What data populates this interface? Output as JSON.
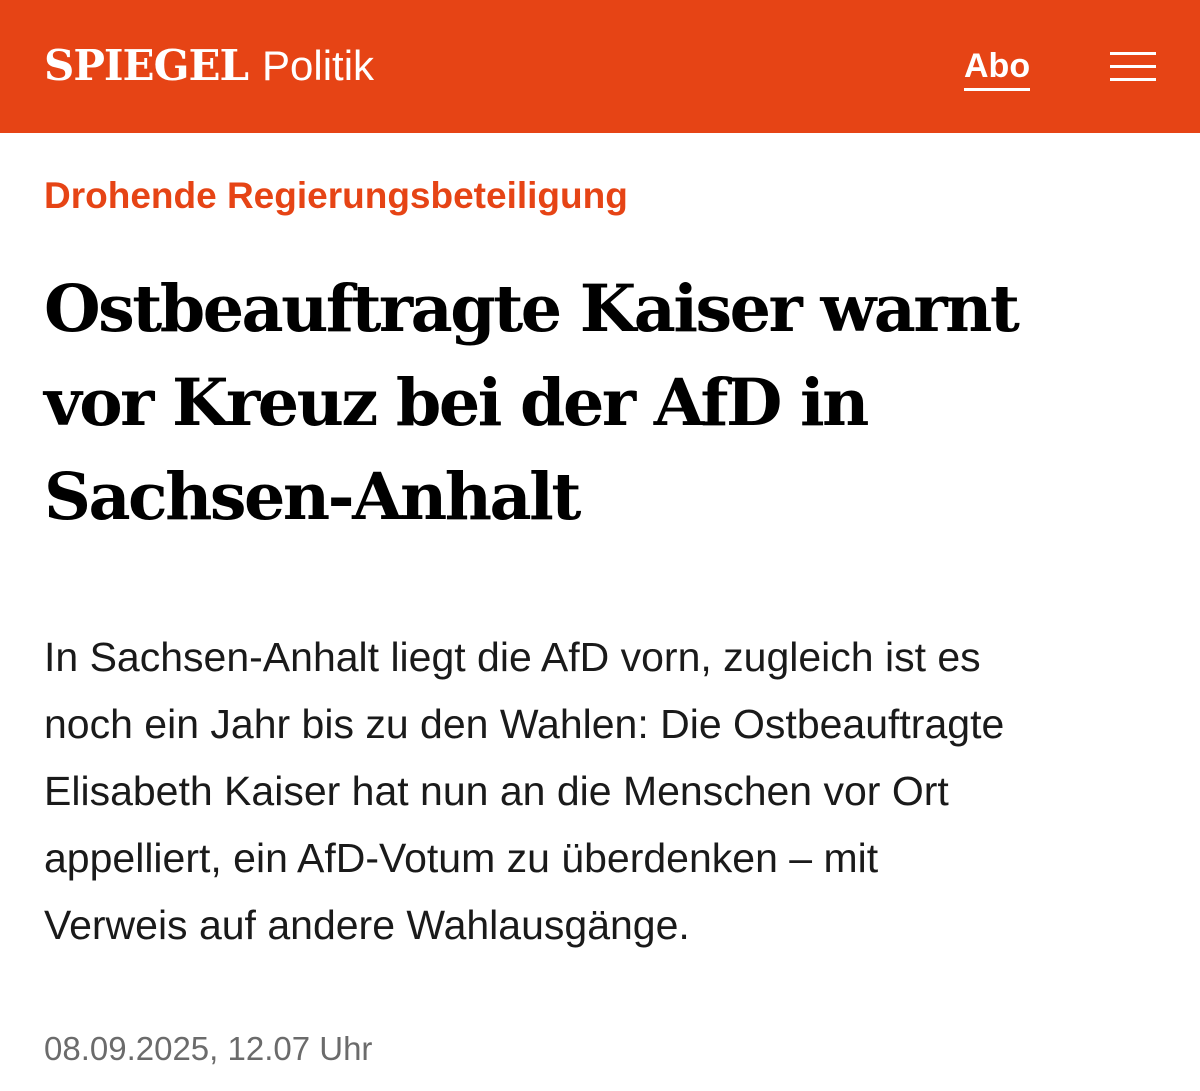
{
  "header": {
    "logo": "SPIEGEL",
    "section": "Politik",
    "abo_label": "Abo",
    "menu_icon": "hamburger-menu-icon",
    "brand_color": "#e64415"
  },
  "article": {
    "kicker": "Drohende Regierungsbeteiligung",
    "headline_lines": [
      "Ostbeauftragte Kaiser warnt",
      "vor Kreuz bei der AfD in",
      "Sachsen-Anhalt"
    ],
    "teaser_lines": [
      "In Sachsen-Anhalt liegt die AfD vorn, zugleich ist es",
      "noch ein Jahr bis zu den Wahlen: Die Ostbeauftragte",
      "Elisabeth Kaiser hat nun an die Menschen vor Ort",
      "appelliert, ein AfD-Votum zu überdenken – mit",
      "Verweis auf andere Wahlausgänge."
    ],
    "date": "08.09.2025, 12.07 Uhr"
  }
}
